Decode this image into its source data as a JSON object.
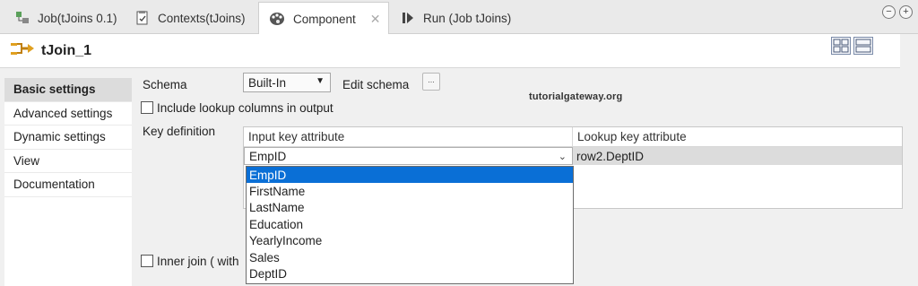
{
  "tabs": [
    {
      "label": "Job(tJoins 0.1)",
      "icon": "job-icon"
    },
    {
      "label": "Contexts(tJoins)",
      "icon": "contexts-icon"
    },
    {
      "label": "Component",
      "icon": "component-icon",
      "active": true
    },
    {
      "label": "Run (Job tJoins)",
      "icon": "run-icon"
    }
  ],
  "component": {
    "title": "tJoin_1"
  },
  "nav": {
    "items": [
      {
        "label": "Basic settings",
        "active": true
      },
      {
        "label": "Advanced settings"
      },
      {
        "label": "Dynamic settings"
      },
      {
        "label": "View"
      },
      {
        "label": "Documentation"
      }
    ]
  },
  "settings": {
    "schema_label": "Schema",
    "schema_value": "Built-In",
    "edit_schema_label": "Edit schema",
    "edit_schema_button": "...",
    "watermark": "tutorialgateway.org",
    "include_lookup_label": "Include lookup columns in output",
    "key_definition_label": "Key definition",
    "inner_join_label": "Inner join ( with"
  },
  "key_table": {
    "headers": [
      "Input key attribute",
      "Lookup key attribute"
    ],
    "input_value": "EmpID",
    "lookup_value": "row2.DeptID"
  },
  "dropdown": {
    "options": [
      "EmpID",
      "FirstName",
      "LastName",
      "Education",
      "YearlyIncome",
      "Sales",
      "DeptID"
    ],
    "selected": "EmpID"
  },
  "colors": {
    "selection": "#0a6fd6",
    "active_nav": "#dcdcdc"
  }
}
